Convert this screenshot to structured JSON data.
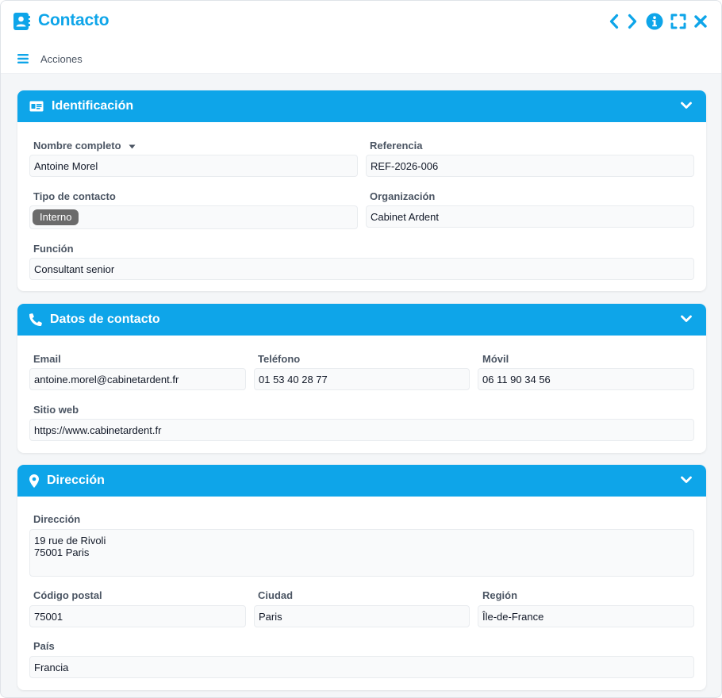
{
  "window": {
    "title": "Contacto",
    "toolbar": {
      "actions_label": "Acciones"
    }
  },
  "colors": {
    "accent": "#0ea5e9",
    "badge": "#6b6b6b"
  },
  "icons": {
    "app": "contact-book-icon",
    "prev": "chevron-left-icon",
    "next": "chevron-right-icon",
    "info": "info-icon",
    "maximize": "maximize-icon",
    "close": "close-icon",
    "menu": "hamburger-menu-icon"
  },
  "sections": {
    "identification": {
      "title": "Identificación",
      "icon": "id-card-icon",
      "full_name_label": "Nombre completo",
      "full_name": "Antoine Morel",
      "reference_label": "Referencia",
      "reference": "REF-2026-006",
      "contact_type_label": "Tipo de contacto",
      "contact_type": "Interno",
      "organization_label": "Organización",
      "organization": "Cabinet Ardent",
      "function_label": "Función",
      "function": "Consultant senior"
    },
    "contact_data": {
      "title": "Datos de contacto",
      "icon": "phone-icon",
      "email_label": "Email",
      "email": "antoine.morel@cabinetardent.fr",
      "phone_label": "Teléfono",
      "phone": "01 53 40 28 77",
      "mobile_label": "Móvil",
      "mobile": "06 11 90 34 56",
      "website_label": "Sitio web",
      "website": "https://www.cabinetardent.fr"
    },
    "address": {
      "title": "Dirección",
      "icon": "map-pin-icon",
      "address_label": "Dirección",
      "address": "19 rue de Rivoli\n75001 Paris",
      "postal_code_label": "Código postal",
      "postal_code": "75001",
      "city_label": "Ciudad",
      "city": "Paris",
      "region_label": "Región",
      "region": "Île-de-France",
      "country_label": "País",
      "country": "Francia"
    }
  }
}
